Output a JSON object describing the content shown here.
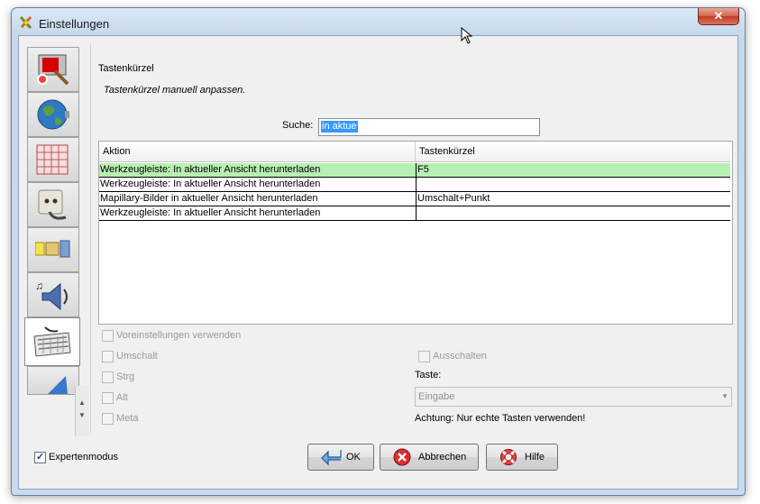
{
  "window": {
    "title": "Einstellungen",
    "close_label": "✕"
  },
  "sidebar": {
    "tabs": [
      {
        "icon": "paint-brush-icon"
      },
      {
        "icon": "globe-icon"
      },
      {
        "icon": "grid-projection-icon"
      },
      {
        "icon": "plug-icon"
      },
      {
        "icon": "toolbar-icon"
      },
      {
        "icon": "speaker-icon"
      },
      {
        "icon": "keyboard-icon",
        "selected": true
      },
      {
        "icon": "remote-control-icon"
      }
    ]
  },
  "panel": {
    "heading": "Tastenkürzel",
    "description": "Tastenkürzel manuell anpassen.",
    "search": {
      "label": "Suche:",
      "value": "in aktue"
    },
    "table": {
      "headers": [
        "Aktion",
        "Tastenkürzel"
      ],
      "rows": [
        {
          "action": "Werkzeugleiste: In aktueller Ansicht herunterladen",
          "shortcut": "F5",
          "selected": true
        },
        {
          "action": "Werkzeugleiste: In aktueller Ansicht herunterladen",
          "shortcut": ""
        },
        {
          "action": "Mapillary-Bilder in aktueller Ansicht herunterladen",
          "shortcut": "Umschalt+Punkt"
        },
        {
          "action": "Werkzeugleiste: In aktueller Ansicht herunterladen",
          "shortcut": ""
        }
      ]
    },
    "options": {
      "use_defaults": "Voreinstellungen verwenden",
      "shift": "Umschalt",
      "ctrl": "Strg",
      "alt": "Alt",
      "meta": "Meta",
      "disable": "Ausschalten",
      "key_label": "Taste:",
      "key_value": "Eingabe",
      "warning": "Achtung: Nur echte Tasten verwenden!"
    }
  },
  "footer": {
    "expert_mode": "Expertenmodus",
    "expert_checked": true,
    "ok": "OK",
    "cancel": "Abbrechen",
    "help": "Hilfe"
  },
  "colors": {
    "selected_row": "#b7f0b2",
    "search_highlight": "#3399ff"
  }
}
